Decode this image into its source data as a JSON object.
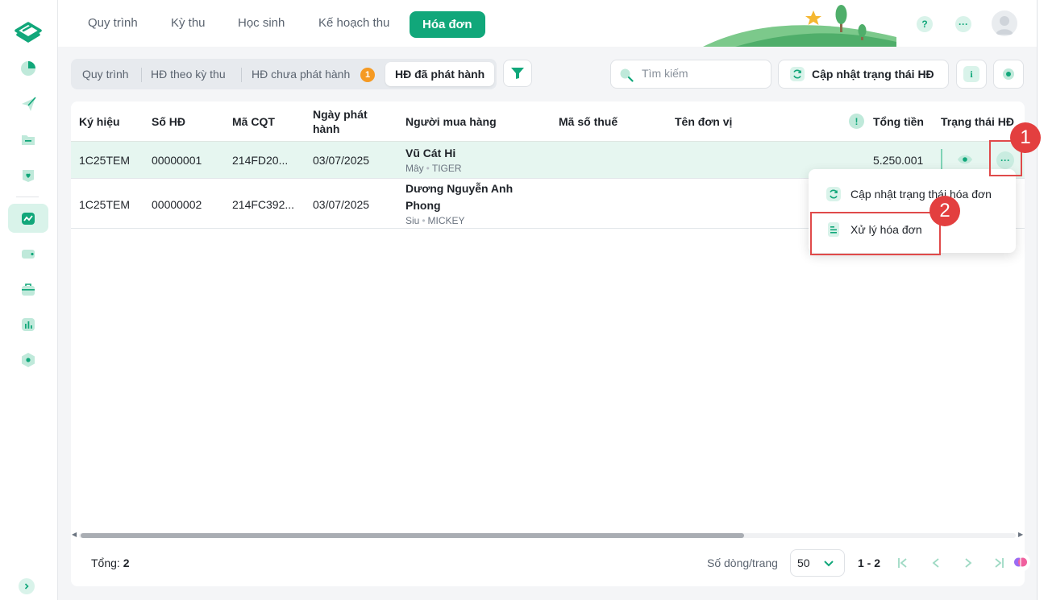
{
  "colors": {
    "accent": "#11a77a",
    "accent_light": "#d9f3ea",
    "badge": "#f59a23",
    "annotation_red": "#e04a4a"
  },
  "topnav": {
    "tabs": [
      {
        "label": "Quy trình"
      },
      {
        "label": "Kỳ thu"
      },
      {
        "label": "Học sinh"
      },
      {
        "label": "Kế hoạch thu"
      },
      {
        "label": "Hóa đơn"
      }
    ],
    "help_icon": "?",
    "more_icon": "···"
  },
  "toolbar": {
    "subtabs": [
      {
        "label": "Quy trình"
      },
      {
        "label": "HĐ theo kỳ thu"
      },
      {
        "label": "HĐ chưa phát hành"
      },
      {
        "label": "HĐ đã phát hành"
      }
    ],
    "unissued_badge": "1",
    "search_placeholder": "Tìm kiếm",
    "update_button": "Cập nhật trạng thái HĐ",
    "info_icon": "i"
  },
  "table": {
    "headers": {
      "symbol": "Ký hiệu",
      "invoice_no": "Số HĐ",
      "tax_code_cqt": "Mã CQT",
      "issue_date_line1": "Ngày phát",
      "issue_date_line2": "hành",
      "buyer": "Người mua hàng",
      "tax_id": "Mã số thuế",
      "unit_name": "Tên đơn vị",
      "total_warn": "!",
      "total": "Tổng tiền",
      "status": "Trạng thái HĐ"
    },
    "rows": [
      {
        "symbol": "1C25TEM",
        "invoice_no": "00000001",
        "tax_code_cqt": "214FD20...",
        "issue_date": "03/07/2025",
        "buyer_name": "Vũ Cát Hi",
        "buyer_class": "Mây",
        "buyer_group": "TIGER",
        "total": "5.250.001"
      },
      {
        "symbol": "1C25TEM",
        "invoice_no": "00000002",
        "tax_code_cqt": "214FC392...",
        "issue_date": "03/07/2025",
        "buyer_name_line1": "Dương Nguyễn Anh",
        "buyer_name_line2": "Phong",
        "buyer_class": "Siu",
        "buyer_group": "MICKEY"
      }
    ],
    "row_more_icon": "···"
  },
  "menu": {
    "items": [
      {
        "label": "Cập nhật trạng thái hóa đơn",
        "icon": "refresh-icon"
      },
      {
        "label": "Xử lý hóa đơn",
        "icon": "document-icon"
      }
    ]
  },
  "annotations": {
    "step1": "1",
    "step2": "2"
  },
  "footer": {
    "total_label": "Tổng:",
    "total_value": "2",
    "rows_per_page_label": "Số dòng/trang",
    "rows_per_page_value": "50",
    "page_range": "1 - 2"
  }
}
